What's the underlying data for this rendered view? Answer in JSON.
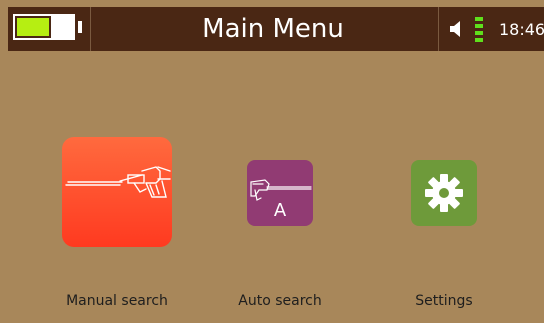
{
  "header": {
    "title": "Main Menu",
    "time": "18:46",
    "battery_level": 0.55,
    "signal_bars": 4,
    "icons": [
      "battery-icon",
      "speaker-icon",
      "signal-icon"
    ]
  },
  "menu": {
    "items": [
      {
        "label": "Manual search",
        "icon": "metal-detector-icon",
        "color": "#ff4a2a"
      },
      {
        "label": "Auto search",
        "icon": "auto-detector-icon",
        "badge": "A",
        "color": "#913b73"
      },
      {
        "label": "Settings",
        "icon": "gear-icon",
        "color": "#6e9a3a"
      }
    ]
  },
  "colors": {
    "background": "#a8875a",
    "topbar": "#4a2714",
    "battery_fill": "#b6ee12",
    "signal": "#5fe01c"
  }
}
